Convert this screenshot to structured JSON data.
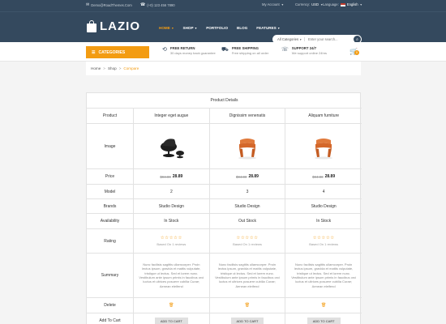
{
  "topbar": {
    "email": "Demo@RoadThemes.Com",
    "phone": "(+0) 123 456 7890",
    "my_account": "My Account",
    "currency_label": "Currency:",
    "currency_value": "USD",
    "language_label": "Language:",
    "language_value": "English"
  },
  "header": {
    "logo_text": "LAZIO",
    "nav": [
      "HOME",
      "SHOP",
      "PORTFOLIO",
      "BLOG",
      "FEATURES"
    ],
    "search_category": "All Categories",
    "search_placeholder": "Enter your search..."
  },
  "strip": {
    "categories_label": "CATEGORIES",
    "features": [
      {
        "title": "FREE RETURN",
        "sub": "30 days money back guarantee"
      },
      {
        "title": "FREE SHIPPING",
        "sub": "Free shipping on all order"
      },
      {
        "title": "SUPPORT 24/7",
        "sub": "We support online 24hrs"
      }
    ],
    "cart_count": "0"
  },
  "breadcrumb": {
    "home": "Home",
    "shop": "Shop",
    "current": "Compare",
    "sep": ">"
  },
  "table": {
    "title": "Product Details",
    "labels": {
      "product": "Product",
      "image": "Image",
      "price": "Price",
      "model": "Model",
      "brands": "Brands",
      "availability": "Availability",
      "rating": "Rating",
      "summary": "Summary",
      "delete": "Delete",
      "add_to_cart": "Add To Cart"
    },
    "products": [
      {
        "name": "Integer eget augue",
        "old_price": "$94.00",
        "price": "28.89",
        "model": "2",
        "brand": "Studio Design",
        "availability": "In Stock",
        "stock_color": "#27ae60",
        "reviews": "Based On 1 reviews",
        "summary": "Nunc facilisis sagittis ullamcorper. Proin lectus ipsum, gravida et mattis vulputate, tristique ut lectus. Sed et lorem nunc. Vestibulum ante ipsum primis in faucibus orci luctus et ultrices posuere cubilia Curae; Aenean eleifend",
        "delete": "🗑",
        "cart_btn": "ADD TO CART",
        "image": "black-lounge-chair"
      },
      {
        "name": "Dignissim venenatis",
        "old_price": "$94.00",
        "price": "28.89",
        "model": "3",
        "brand": "Studio Design",
        "availability": "Out Stock",
        "stock_color": "#e74c3c",
        "reviews": "Based On 1 reviews",
        "summary": "Nunc facilisis sagittis ullamcorper. Proin lectus ipsum, gravida et mattis vulputate, tristique ut lectus. Sed et lorem nunc. Vestibulum ante ipsum primis in faucibus orci luctus et ultrices posuere cubilia Curae; Aenean eleifend",
        "delete": "🗑",
        "cart_btn": "ADD TO CART",
        "image": "orange-chair"
      },
      {
        "name": "Aliquam furniture",
        "old_price": "$94.00",
        "price": "28.89",
        "model": "4",
        "brand": "Studio Design",
        "availability": "In Stock",
        "stock_color": "#27ae60",
        "reviews": "Based On 1 reviews",
        "summary": "Nunc facilisis sagittis ullamcorper. Proin lectus ipsum, gravida et mattis vulputate, tristique ut lectus. Sed et lorem nunc. Vestibulum ante ipsum primis in faucibus orci luctus et ultrices posuere cubilia Curae; Aenean eleifend",
        "delete": "🗑",
        "cart_btn": "ADD TO CART",
        "image": "orange-chair"
      }
    ]
  },
  "colors": {
    "header_bg": "#34495e",
    "accent": "#f39c12"
  }
}
